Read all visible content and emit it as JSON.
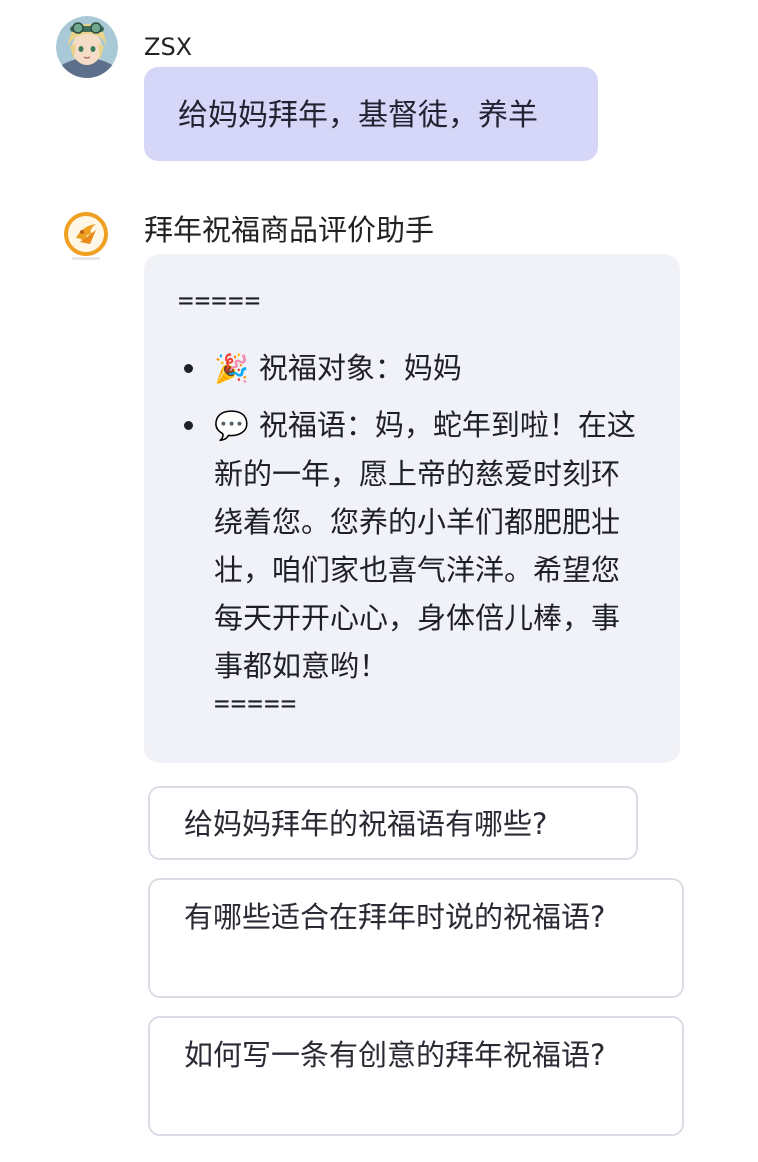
{
  "user_message": {
    "name": "ZSX",
    "text": "给妈妈拜年，基督徒，养羊",
    "avatar_icon": "anime-avatar-icon"
  },
  "bot_message": {
    "name": "拜年祝福商品评价助手",
    "avatar_icon": "fire-logo-icon",
    "separator_top": "=====",
    "items": [
      {
        "emoji": "🎉",
        "emoji_icon": "party-popper-icon",
        "text": "祝福对象：妈妈"
      },
      {
        "emoji": "💬",
        "emoji_icon": "speech-bubble-icon",
        "text": "祝福语：妈，蛇年到啦！在这新的一年，愿上帝的慈爱时刻环绕着您。您养的小羊们都肥肥壮壮，咱们家也喜气洋洋。希望您每天开开心心，身体倍儿棒，事事都如意哟！"
      }
    ],
    "separator_bottom": "====="
  },
  "suggestions": [
    "给妈妈拜年的祝福语有哪些?",
    "有哪些适合在拜年时说的祝福语?",
    "如何写一条有创意的拜年祝福语?"
  ],
  "colors": {
    "user_bubble": "#d6d6f8",
    "bot_bubble": "#f1f2f7",
    "chip_border": "#dcdce6",
    "logo_orange": "#f0a020"
  }
}
